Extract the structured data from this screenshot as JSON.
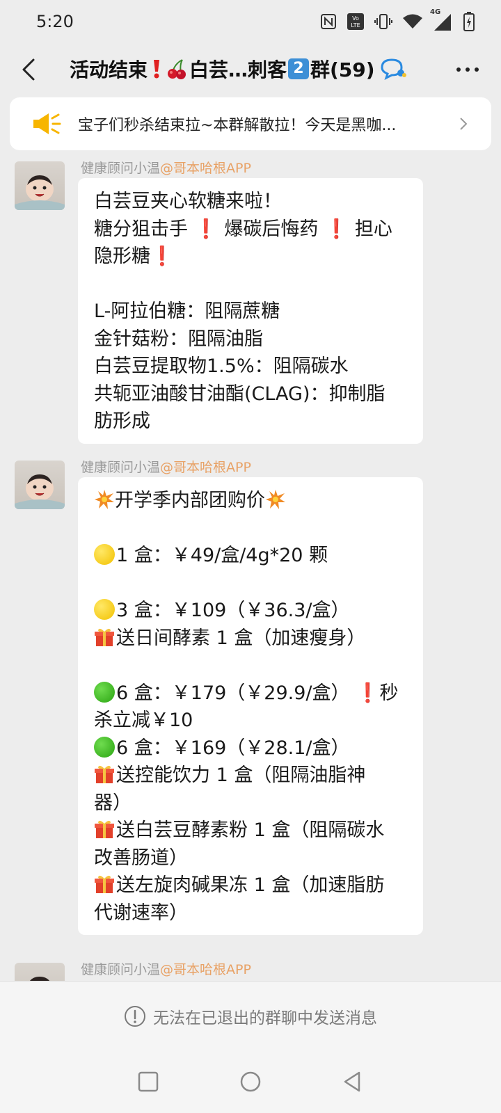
{
  "status_bar": {
    "time": "5:20",
    "icons": [
      "nfc-icon",
      "volte-icon",
      "vibrate-icon",
      "wifi-icon",
      "signal-4g-icon",
      "battery-charging-icon"
    ],
    "network": "4G"
  },
  "header": {
    "title_part1": "活动结束",
    "title_part2": "白芸…刺客",
    "title_num": "2",
    "title_part3": "群(59)"
  },
  "announcement": {
    "text": "宝子们秒杀结束拉~本群解散拉！今天是黑咖..."
  },
  "messages": [
    {
      "sender_name": "健康顾问小温",
      "sender_tag": "@哥本哈根APP",
      "lines": [
        "白芸豆夹心软糖来啦！",
        "糖分狙击手",
        "爆碳后悔药",
        "担心",
        "隐形糖",
        "",
        "L-阿拉伯糖：阻隔蔗糖",
        "金针菇粉：阻隔油脂",
        "白芸豆提取物1.5%：阻隔碳水",
        "共轭亚油酸甘油酯(CLAG)：抑制脂",
        "肪形成"
      ]
    },
    {
      "sender_name": "健康顾问小温",
      "sender_tag": "@哥本哈根APP",
      "lines": [
        "开学季内部团购价",
        "",
        "1 盒：￥49/盒/4g*20 颗",
        "",
        "3 盒：￥109（￥36.3/盒）",
        "送日间酵素 1 盒（加速瘦身）",
        "",
        "6 盒：￥179（￥29.9/盒）",
        "秒",
        "杀立减￥10",
        "6 盒：￥169（￥28.1/盒）",
        "送控能饮力 1 盒（阻隔油脂神",
        "器）",
        "送白芸豆酵素粉 1 盒（阻隔碳水",
        "改善肠道）",
        "送左旋肉碱果冻 1 盒（加速脂肪",
        "代谢速率）"
      ]
    },
    {
      "sender_name": "健康顾问小温",
      "sender_tag": "@哥本哈根APP"
    }
  ],
  "bottom_notice": "无法在已退出的群聊中发送消息",
  "colors": {
    "background": "#ededed",
    "bubble": "#ffffff",
    "sender_tag": "#e8a266",
    "exclamation": "#e02020",
    "megaphone": "#f7b500"
  }
}
